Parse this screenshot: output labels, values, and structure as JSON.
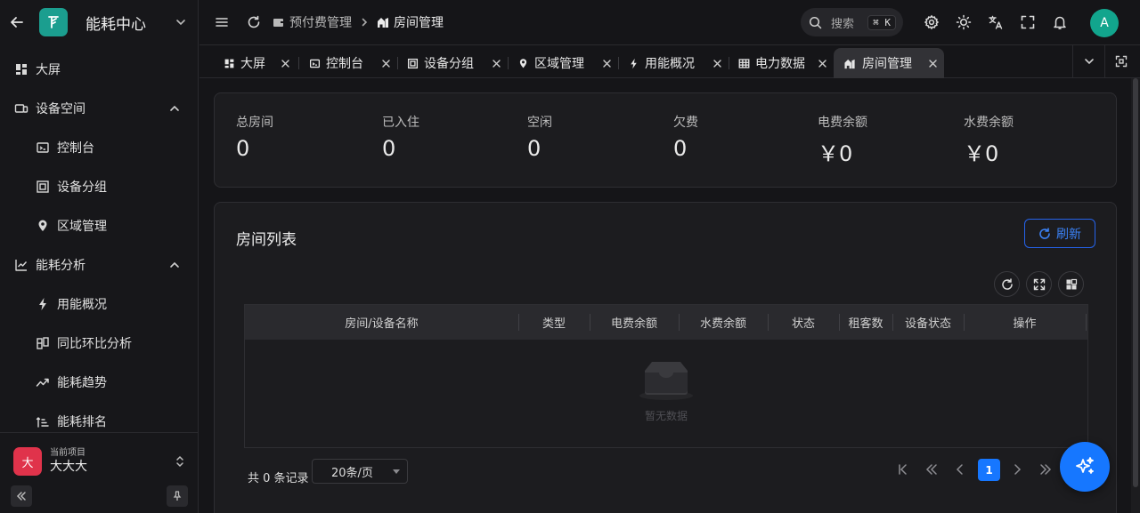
{
  "sidebar": {
    "app_title": "能耗中心",
    "items": [
      {
        "label": "大屏",
        "icon": "dashboard-icon"
      },
      {
        "label": "设备空间",
        "icon": "monitor-icon"
      },
      {
        "label": "控制台",
        "icon": "console-icon"
      },
      {
        "label": "设备分组",
        "icon": "group-icon"
      },
      {
        "label": "区域管理",
        "icon": "location-icon"
      },
      {
        "label": "能耗分析",
        "icon": "chart-icon"
      },
      {
        "label": "用能概况",
        "icon": "bolt-icon"
      },
      {
        "label": "同比环比分析",
        "icon": "compare-icon"
      },
      {
        "label": "能耗趋势",
        "icon": "trend-icon"
      },
      {
        "label": "能耗排名",
        "icon": "rank-icon"
      }
    ],
    "project": {
      "avatar": "大",
      "label": "当前项目",
      "name": "大大大"
    }
  },
  "header": {
    "breadcrumbs": [
      "预付费管理",
      "房间管理"
    ],
    "search_placeholder": "搜索",
    "search_shortcut": "⌘ K",
    "user_initial": "A"
  },
  "tabs": [
    "大屏",
    "控制台",
    "设备分组",
    "区域管理",
    "用能概况",
    "电力数据",
    "房间管理"
  ],
  "stats": [
    {
      "label": "总房间",
      "value": "0"
    },
    {
      "label": "已入住",
      "value": "0"
    },
    {
      "label": "空闲",
      "value": "0"
    },
    {
      "label": "欠费",
      "value": "0"
    },
    {
      "label": "电费余额",
      "value": "￥0"
    },
    {
      "label": "水费余额",
      "value": "￥0"
    }
  ],
  "room_list": {
    "title": "房间列表",
    "refresh_label": "刷新",
    "columns": [
      "房间/设备名称",
      "类型",
      "电费余额",
      "水费余额",
      "状态",
      "租客数",
      "设备状态",
      "操作"
    ],
    "empty_text": "暂无数据"
  },
  "pagination": {
    "total_text": "共 0 条记录",
    "page_size": "20条/页",
    "current_page": "1"
  },
  "colors": {
    "accent": "#1677ff",
    "logo": "#1b9e8f",
    "avatar": "#12a58d",
    "project": "#e0334b"
  }
}
